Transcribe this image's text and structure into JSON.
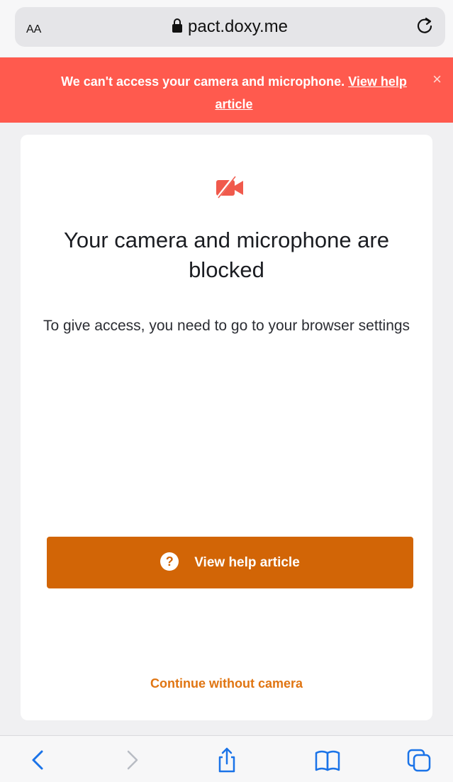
{
  "browser": {
    "text_size_label": "AA",
    "url": "pact.doxy.me"
  },
  "banner": {
    "message": "We can't access your camera and microphone.",
    "link_text": "View help article",
    "close_symbol": "×",
    "background_color": "#ff5a4e"
  },
  "card": {
    "icon": "camera-off-icon",
    "title": "Your camera and microphone are blocked",
    "description": "To give access, you need to go to your browser settings",
    "help_button_icon": "?",
    "help_button_label": "View help article",
    "help_button_color": "#d26506",
    "continue_label": "Continue without camera",
    "continue_color": "#e07512"
  },
  "toolbar": {
    "items": [
      "back-icon",
      "forward-icon",
      "share-icon",
      "bookmarks-icon",
      "tabs-icon"
    ],
    "accent_color": "#1a73e8"
  }
}
